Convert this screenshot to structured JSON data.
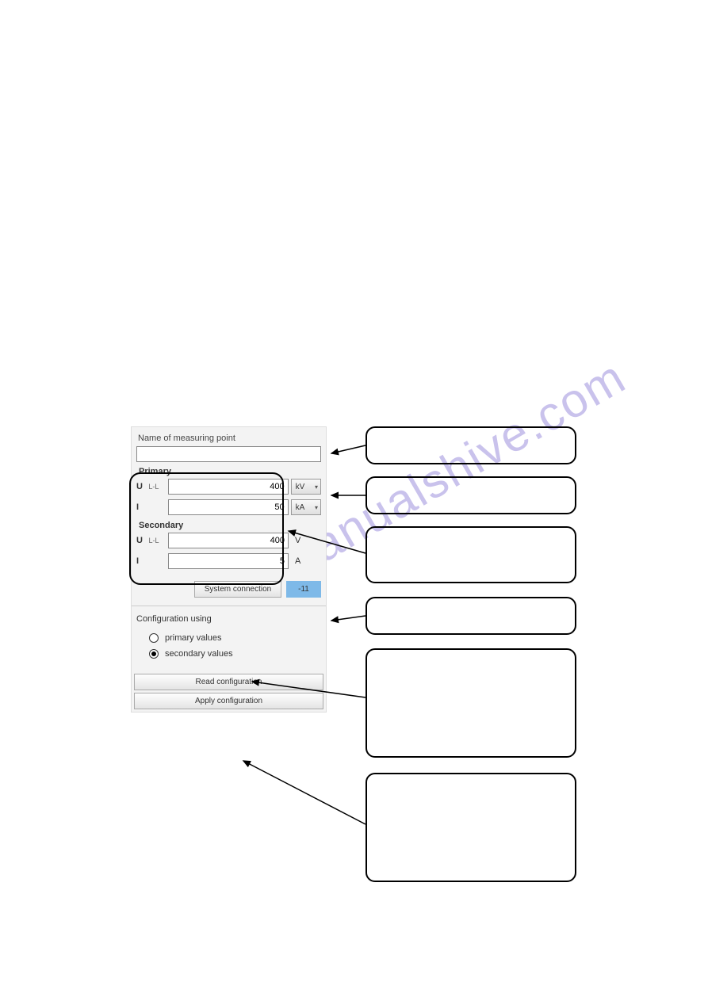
{
  "watermark_text": "manualshive.com",
  "name_label": "Name of measuring point",
  "name_value": "",
  "primary": {
    "title": "Primary",
    "u_label": "U",
    "u_sub": "L-L",
    "u_value": "400",
    "u_unit": "kV",
    "i_label": "I",
    "i_sub": "",
    "i_value": "50",
    "i_unit": "kA"
  },
  "secondary": {
    "title": "Secondary",
    "u_label": "U",
    "u_sub": "L-L",
    "u_value": "400",
    "u_unit": "V",
    "i_label": "I",
    "i_sub": "",
    "i_value": "5",
    "i_unit": "A"
  },
  "system_connection_label": "System connection",
  "system_connection_value": "-11",
  "config_using_title": "Configuration using",
  "radio_primary_label": "primary values",
  "radio_secondary_label": "secondary values",
  "radio_selected": "secondary",
  "read_btn": "Read configuration",
  "apply_btn": "Apply configuration"
}
